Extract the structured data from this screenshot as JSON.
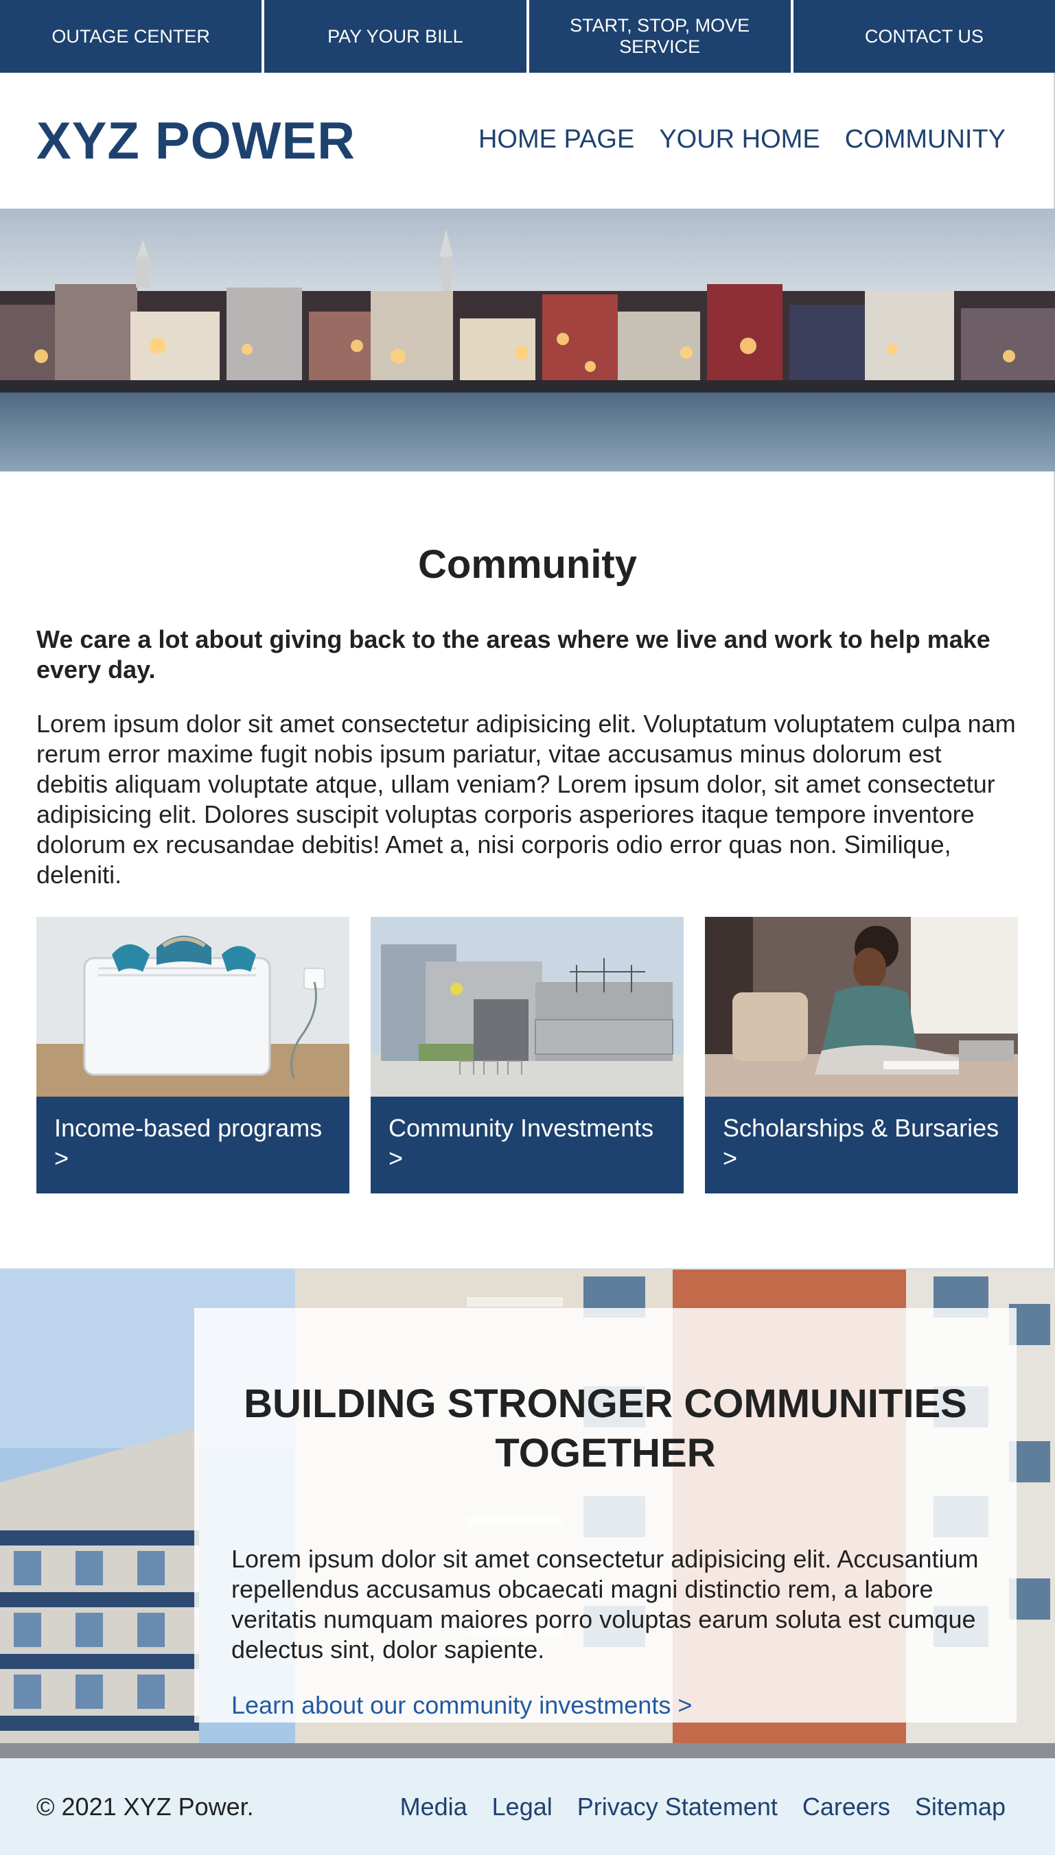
{
  "top_bar": {
    "items": [
      "OUTAGE CENTER",
      "PAY YOUR BILL",
      "START, STOP, MOVE SERVICE",
      "CONTACT US"
    ]
  },
  "header": {
    "logo": "XYZ POWER",
    "nav": [
      "HOME PAGE",
      "YOUR HOME",
      "COMMUNITY"
    ]
  },
  "main": {
    "title": "Community",
    "lead": "We care a lot about giving back to the areas where we live and work to help make every day.",
    "body": "Lorem ipsum dolor sit amet consectetur adipisicing elit. Voluptatum voluptatem culpa nam rerum error maxime fugit nobis ipsum pariatur, vitae accusamus minus dolorum est debitis aliquam voluptate atque, ullam veniam? Lorem ipsum dolor, sit amet consectetur adipisicing elit. Dolores suscipit voluptas corporis asperiores itaque tempore inventore dolorum ex recusandae debitis! Amet a, nisi corporis odio error quas non. Similique, deleniti.",
    "cards": [
      {
        "label": "Income-based programs >"
      },
      {
        "label": "Community Investments >"
      },
      {
        "label": "Scholarships & Bursaries >"
      }
    ]
  },
  "feature": {
    "title": "BUILDING STRONGER COMMUNITIES TOGETHER",
    "body": "Lorem ipsum dolor sit amet consectetur adipisicing elit. Accusantium repellendus accusamus obcaecati magni distinctio rem, a labore veritatis numquam maiores porro voluptas earum soluta est cumque delectus sint, dolor sapiente.",
    "link": "Learn about our community investments >"
  },
  "footer": {
    "copyright": "© 2021 XYZ Power.",
    "links": [
      "Media",
      "Legal",
      "Privacy Statement",
      "Careers",
      "Sitemap"
    ]
  },
  "colors": {
    "brand_navy": "#1e426f",
    "link_blue": "#2359a3",
    "footer_bg": "#e6f0f7"
  }
}
